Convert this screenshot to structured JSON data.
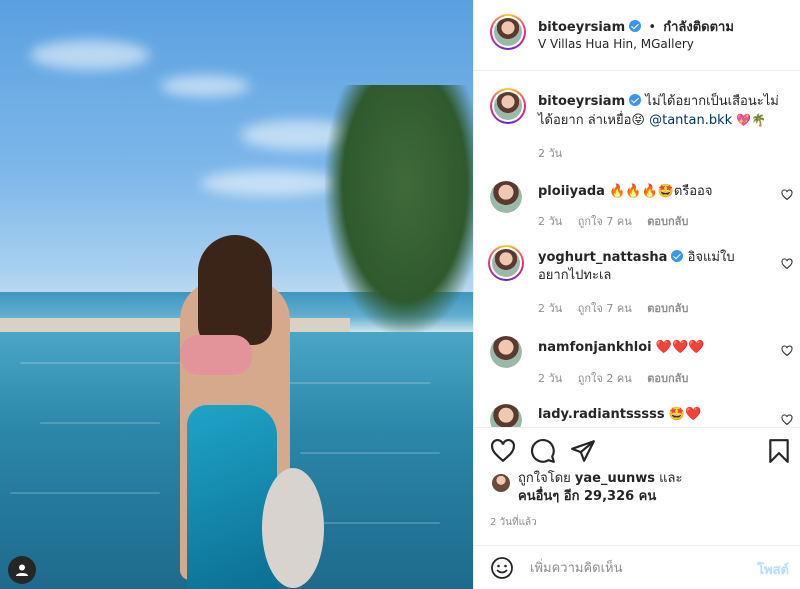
{
  "post": {
    "username": "bitoeyrsiam",
    "separator": "•",
    "follow_status": "กำลังติดตาม",
    "location": "V Villas Hua Hin, MGallery",
    "caption_text": "ไม่ได้อยากเป็นเสือนะไม่ได้อยาก ล่าเหยื่อ😝",
    "caption_mention": "@tantan.bkk",
    "caption_emoji": "💖🌴",
    "caption_time": "2 วัน"
  },
  "comments": [
    {
      "username": "ploiiyada",
      "text": "🔥🔥🔥🤩ตรืออจ",
      "time": "2 วัน",
      "likes": "ถูกใจ 7 คน",
      "reply": "ตอบกลับ"
    },
    {
      "username": "yoghurt_nattasha",
      "verified": true,
      "text": "อิจแม่ใบ อยากไปทะเล",
      "time": "2 วัน",
      "likes": "ถูกใจ 7 คน",
      "reply": "ตอบกลับ"
    },
    {
      "username": "namfonjankhloi",
      "text": "❤️❤️❤️",
      "time": "2 วัน",
      "likes": "ถูกใจ 2 คน",
      "reply": "ตอบกลับ"
    },
    {
      "username": "lady.radiantsssss",
      "text": "🤩❤️",
      "time": "",
      "likes": "",
      "reply": ""
    }
  ],
  "likes": {
    "liked_by_prefix": "ถูกใจโดย",
    "liked_by_user": "yae_uunws",
    "liked_by_suffix": "และ",
    "others": "คนอื่นๆ อีก 29,326 คน"
  },
  "post_time": "2 วันที่แล้ว",
  "add_comment": {
    "placeholder": "เพิ่มความคิดเห็น",
    "post_label": "โพสต์"
  },
  "colors": {
    "accent": "#3897f0",
    "heart": "#ed4956",
    "post_disabled": "#b2dffc",
    "muted": "#8e8e8e"
  },
  "icons": [
    "heart-icon",
    "comment-icon",
    "share-icon",
    "bookmark-icon",
    "emoji-icon",
    "user-tag-icon",
    "verified-icon"
  ]
}
